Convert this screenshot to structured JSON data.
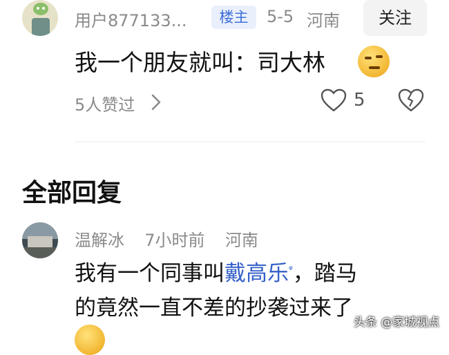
{
  "op_comment": {
    "username": "用户877133...",
    "op_badge": "楼主",
    "date": "5-5",
    "location": "河南",
    "follow_label": "关注",
    "text": "我一个朋友就叫：司大林",
    "likers_text": "5人赞过",
    "like_count": "5",
    "icons": [
      "user-avatar",
      "smirk-emoji",
      "chevron-right-icon",
      "heart-icon",
      "broken-heart-icon"
    ]
  },
  "replies_section": {
    "title": "全部回复"
  },
  "reply": {
    "username": "温解冰",
    "time": "7小时前",
    "location": "河南",
    "line1_before": "我有一个同事叫",
    "line1_link": "戴高乐",
    "line1_link_icon": "ᵠ",
    "line1_after": "，踏马",
    "line2": "的竟然一直不差的抄袭过来了"
  },
  "watermark": "头条 @家城视点",
  "colors": {
    "meta_gray": "#8a8a8a",
    "badge_blue": "#3e6fd8",
    "badge_bg": "#eaf0fb",
    "link_blue": "#3460c8"
  }
}
